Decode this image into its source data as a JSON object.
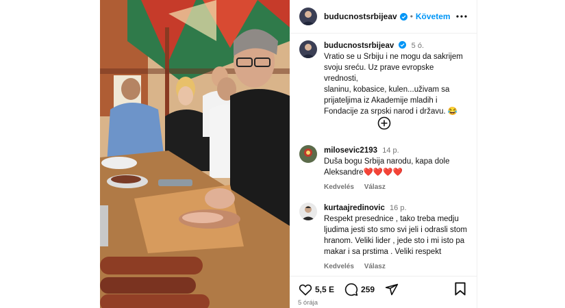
{
  "post": {
    "author": "buducnostsrbijeav",
    "follow_label": "Követem",
    "separator": "•"
  },
  "caption": {
    "author": "buducnostsrbijeav",
    "time": "5 ó.",
    "text": "Vratio se u Srbiju i ne mogu da sakrijem\nsvoju sreću. Uz prave evropske vrednosti,\nslaninu, kobasice, kulen...uživam sa\nprijateljima iz Akademije mladih i\nFondacije za srpski narod i državu. 😂"
  },
  "comments": [
    {
      "author": "milosevic2193",
      "time": "14 p.",
      "text": "Duša bogu Srbija narodu, kapa dole\nAleksandre❤️❤️❤️❤️",
      "like_label": "Kedvelés",
      "reply_label": "Válasz"
    },
    {
      "author": "kurtaajredinovic",
      "time": "16 p.",
      "text": "Respekt presednice , tako treba medju\nljudima jesti sto smo svi jeli i odrasli stom\nhranom. Veliki lider , jede sto i mi isto pa\nmakar i sa prstima . Veliki respekt",
      "like_label": "Kedvelés",
      "reply_label": "Válasz"
    }
  ],
  "actions": {
    "likes": "5,5 E",
    "comments": "259",
    "posted_ago": "5 órája"
  },
  "icons": {
    "verified": "verified-badge-icon",
    "more": "more-options-icon",
    "add": "add-circle-icon",
    "like": "heart-icon",
    "comment": "comment-bubble-icon",
    "share": "share-paper-plane-icon",
    "save": "bookmark-icon"
  },
  "colors": {
    "accent": "#0095f6",
    "muted": "#737373",
    "divider": "#efefef"
  }
}
